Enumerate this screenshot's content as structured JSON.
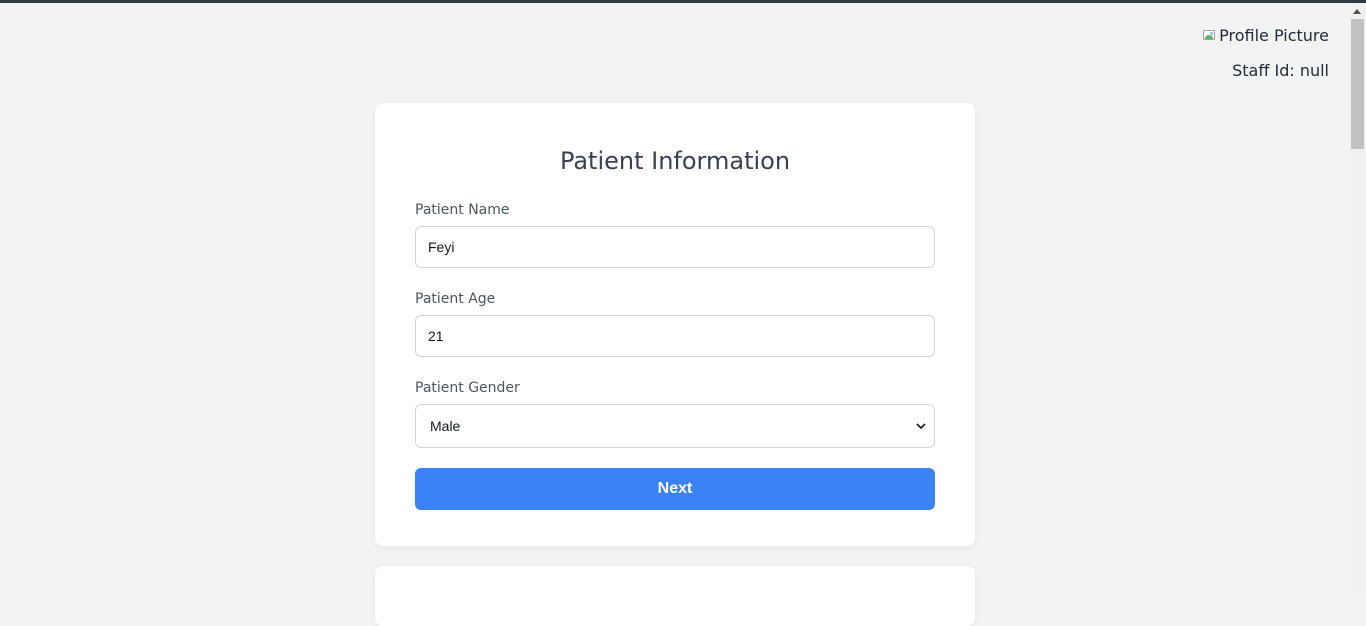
{
  "header": {
    "profile_picture_alt": "Profile Picture",
    "staff_label": "Staff Id: null"
  },
  "form": {
    "title": "Patient Information",
    "name_label": "Patient Name",
    "name_value": "Feyi",
    "age_label": "Patient Age",
    "age_value": "21",
    "gender_label": "Patient Gender",
    "gender_value": "Male",
    "next_label": "Next"
  },
  "colors": {
    "accent": "#3b82f6",
    "background": "#f2f3f5"
  }
}
